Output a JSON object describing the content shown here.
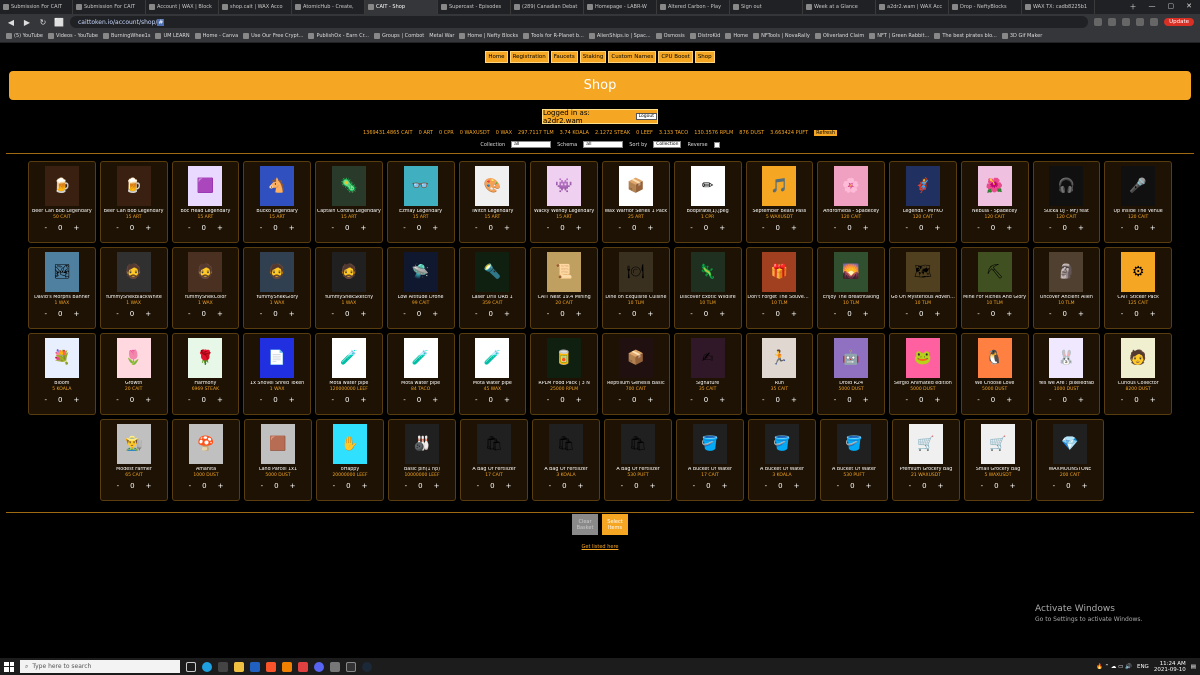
{
  "browser": {
    "tabs": [
      {
        "title": "Submission For CAIT",
        "active": false
      },
      {
        "title": "Submission For CAIT",
        "active": false
      },
      {
        "title": "Account | WAX | Block",
        "active": false
      },
      {
        "title": "shop.cait | WAX Acco",
        "active": false
      },
      {
        "title": "AtomicHub - Create, ",
        "active": false
      },
      {
        "title": "CAIT - Shop",
        "active": true
      },
      {
        "title": "Supercast - Episodes",
        "active": false
      },
      {
        "title": "(289) Canadian Debat",
        "active": false
      },
      {
        "title": "Homepage - LABR-W",
        "active": false
      },
      {
        "title": "Altered Carbon - Play",
        "active": false
      },
      {
        "title": "Sign out",
        "active": false
      },
      {
        "title": "Week at a Glance",
        "active": false
      },
      {
        "title": "a2dr2.wam | WAX Acc",
        "active": false
      },
      {
        "title": "Drop - NeftyBlocks",
        "active": false
      },
      {
        "title": "WAX TX: cadb8225b1",
        "active": false
      }
    ],
    "url_prefix": "caittoken.io/account/shop/",
    "url_selected": "#",
    "update_label": "Update",
    "bookmarks": [
      "(5) YouTube",
      "Videos - YouTube",
      "BurningWhee1s",
      "UM LEARN",
      "Home - Canva",
      "Use Our Free Crypt...",
      "PublishOx - Earn Cr...",
      "Groups | Combot",
      "Home | Nefty Blocks",
      "Tools for R-Planet b...",
      "AlienShips.io | Spac...",
      "Osmosis",
      "DistroKid",
      "Home",
      "NFTools | NovaRally",
      "Oliverland Claim",
      "NFT | Green Rabbit...",
      "The best pirates blo...",
      "3D Gif Maker"
    ],
    "metal_war": "Metal War"
  },
  "nav": [
    "Home",
    "Registration",
    "Faucets",
    "Staking",
    "Custom Names",
    "CPU Boost",
    "Shop"
  ],
  "banner_title": "Shop",
  "login": {
    "text": "Logged in as: a2dr2.wam",
    "logout": "Logout"
  },
  "balances": [
    "1369431.4865 CAIT",
    "0 ART",
    "0 CPR",
    "0 WAXUSDT",
    "0 WAX",
    "297.7117 TLM",
    "3.74 KOALA",
    "2.1272 STEAK",
    "0 LEEF",
    "3.133 TACO",
    "130.3576 RPLM",
    "876 DUST",
    "3.663424 PUFT"
  ],
  "refresh_label": "Refresh",
  "filters": {
    "collection_label": "Collection",
    "collection_value": "all",
    "schema_label": "Schema",
    "schema_value": "all",
    "sort_label": "Sort by",
    "sort_value": "Collection",
    "reverse_label": "Reverse"
  },
  "qty_minus": "-",
  "qty_value": "0",
  "qty_plus": "+",
  "rows": [
    [
      {
        "name": "Beer Can Bob Legendary",
        "price": "50 CAIT",
        "icon": "🍺",
        "bg": "#3a2010"
      },
      {
        "name": "Beer Can Bob Legendary",
        "price": "15 ART",
        "icon": "🍺",
        "bg": "#3a2010"
      },
      {
        "name": "Boc Head Legendary",
        "price": "15 ART",
        "icon": "🟪",
        "bg": "#e9d8ff"
      },
      {
        "name": "Bucko Legendary",
        "price": "15 ART",
        "icon": "🐴",
        "bg": "#3050c0"
      },
      {
        "name": "Captain Corona Legendary",
        "price": "15 ART",
        "icon": "🦠",
        "bg": "#2a3a2a"
      },
      {
        "name": "Ezmay Legendary",
        "price": "15 ART",
        "icon": "👓",
        "bg": "#40b0c0"
      },
      {
        "name": "Twitch Legendary",
        "price": "15 ART",
        "icon": "🎨",
        "bg": "#f0f0f0"
      },
      {
        "name": "Wacky Wendy Legendary",
        "price": "15 ART",
        "icon": "👾",
        "bg": "#f0d0f0"
      },
      {
        "name": "Wax Warrior Series 1 Pack",
        "price": "25 ART",
        "icon": "📦",
        "bg": "#ffffff"
      },
      {
        "name": "Bodpirate(1).jpeg",
        "price": "1 CPR",
        "icon": "✏",
        "bg": "#ffffff"
      },
      {
        "name": "September Beats Pass",
        "price": "5 WAXUSDT",
        "icon": "🎵",
        "bg": "#f5a623"
      },
      {
        "name": "Andromeda - Spadecey",
        "price": "120 CAIT",
        "icon": "🌸",
        "bg": "#f0a0c0"
      },
      {
        "name": "Legends - MIYKO",
        "price": "120 CAIT",
        "icon": "🦸",
        "bg": "#203060"
      },
      {
        "name": "Nebula - Spadecey",
        "price": "120 CAIT",
        "icon": "🌺",
        "bg": "#f0c0e0"
      },
      {
        "name": "Sucka DJ - MFJ feat",
        "price": "120 CAIT",
        "icon": "🎧",
        "bg": "#101010"
      },
      {
        "name": "Up Inside The Venue",
        "price": "120 CAIT",
        "icon": "🎤",
        "bg": "#101010"
      }
    ],
    [
      {
        "name": "David's Morphs Banner",
        "price": "1 WAX",
        "icon": "🏞",
        "bg": "#5080a0"
      },
      {
        "name": "YummySnekBlackWhite",
        "price": "1 WAX",
        "icon": "🧔",
        "bg": "#303030"
      },
      {
        "name": "YummySnekColor",
        "price": "1 WAX",
        "icon": "🧔",
        "bg": "#4a3020"
      },
      {
        "name": "YummySnekGlory",
        "price": "1 WAX",
        "icon": "🧔",
        "bg": "#304050"
      },
      {
        "name": "YummySnekSketchy",
        "price": "1 WAX",
        "icon": "🧔",
        "bg": "#202020"
      },
      {
        "name": "Low Altitude Drone",
        "price": "99 CAIT",
        "icon": "🛸",
        "bg": "#101830"
      },
      {
        "name": "Laser Drill ORB 1",
        "price": "359 CAIT",
        "icon": "🔦",
        "bg": "#102010"
      },
      {
        "name": "CAIT Nest 19.4 Mining",
        "price": "20 CAIT",
        "icon": "📜",
        "bg": "#c0a060"
      },
      {
        "name": "Dine on Exquisite Cuisine",
        "price": "10 TLM",
        "icon": "🍽",
        "bg": "#3a3020"
      },
      {
        "name": "Discover Exotic Wildlife",
        "price": "10 TLM",
        "icon": "🦎",
        "bg": "#203020"
      },
      {
        "name": "Don't Forget The Souvenirs",
        "price": "10 TLM",
        "icon": "🎁",
        "bg": "#a04020"
      },
      {
        "name": "Enjoy The Breathtaking",
        "price": "10 TLM",
        "icon": "🌄",
        "bg": "#305030"
      },
      {
        "name": "Go On Mysterious Adventure",
        "price": "10 TLM",
        "icon": "🗺",
        "bg": "#504020"
      },
      {
        "name": "Mine For Riches And Glory",
        "price": "10 TLM",
        "icon": "⛏",
        "bg": "#405020"
      },
      {
        "name": "Uncover Ancient Alien",
        "price": "10 TLM",
        "icon": "🗿",
        "bg": "#504030"
      },
      {
        "name": "CAIT Sticker Pack",
        "price": "125 CAIT",
        "icon": "⚙",
        "bg": "#f5a623"
      }
    ],
    [
      {
        "name": "Bloom",
        "price": "5 KOALA",
        "icon": "💐",
        "bg": "#e8f0ff"
      },
      {
        "name": "Growth",
        "price": "20 CAIT",
        "icon": "🌷",
        "bg": "#ffd8e0"
      },
      {
        "name": "Harmony",
        "price": "6969 STEAK",
        "icon": "🌹",
        "bg": "#e8f8e8"
      },
      {
        "name": "1x Shovel Shred Token",
        "price": "1 WAX",
        "icon": "📄",
        "bg": "#2030e0"
      },
      {
        "name": "Mota water pipe",
        "price": "120000000 LEEF",
        "icon": "🧪",
        "bg": "#ffffff"
      },
      {
        "name": "Mota water pipe",
        "price": "84 TACO",
        "icon": "🧪",
        "bg": "#ffffff"
      },
      {
        "name": "Mota water pipe",
        "price": "45 WAX",
        "icon": "🧪",
        "bg": "#ffffff"
      },
      {
        "name": "RPLM Food Pack | 3 N",
        "price": "25000 RPLM",
        "icon": "🥫",
        "bg": "#102010"
      },
      {
        "name": "Reptilium Genesis Basic",
        "price": "700 CAIT",
        "icon": "📦",
        "bg": "#201010"
      },
      {
        "name": "Signature",
        "price": "35 CAIT",
        "icon": "✍",
        "bg": "#301828"
      },
      {
        "name": "Run",
        "price": "35 CAIT",
        "icon": "🏃",
        "bg": "#e0d8d0"
      },
      {
        "name": "Droid R24",
        "price": "5000 DUST",
        "icon": "🤖",
        "bg": "#9070c0"
      },
      {
        "name": "Sergio Animated edition",
        "price": "5000 DUST",
        "icon": "🐸",
        "bg": "#ff60a0"
      },
      {
        "name": "We Choose Love",
        "price": "5000 DUST",
        "icon": "🐧",
        "bg": "#ff8040"
      },
      {
        "name": "Yes we Are : pixeledfab",
        "price": "1000 DUST",
        "icon": "🐰",
        "bg": "#f0e8ff"
      },
      {
        "name": "Curious Collector",
        "price": "8200 DUST",
        "icon": "🧑",
        "bg": "#f0f0d0"
      }
    ],
    [
      {
        "name": "Modest Farmer",
        "price": "65 CAIT",
        "icon": "👨‍🌾",
        "bg": "#c0c0c0"
      },
      {
        "name": "Amanita",
        "price": "1000 DUST",
        "icon": "🍄",
        "bg": "#c0c0c0"
      },
      {
        "name": "Land Parcel 1x1",
        "price": "5000 DUST",
        "icon": "🟫",
        "bg": "#c0c0c0"
      },
      {
        "name": "oHappy",
        "price": "20000000 LEEF",
        "icon": "✋",
        "bg": "#30e0ff"
      },
      {
        "name": "Basic pin(1 hp)",
        "price": "10000000 LEEF",
        "icon": "🎳",
        "bg": "#202020"
      },
      {
        "name": "A Bag Of Fertilizer",
        "price": "17 CAIT",
        "icon": "🛍",
        "bg": "#202020"
      },
      {
        "name": "A Bag Of Fertilizer",
        "price": "3 KOALA",
        "icon": "🛍",
        "bg": "#202020"
      },
      {
        "name": "A Bag Of Fertilizer",
        "price": "530 PUFT",
        "icon": "🛍",
        "bg": "#202020"
      },
      {
        "name": "A Bucket Of Water",
        "price": "17 CAIT",
        "icon": "🪣",
        "bg": "#202020"
      },
      {
        "name": "A Bucket Of Water",
        "price": "3 KOALA",
        "icon": "🪣",
        "bg": "#202020"
      },
      {
        "name": "A Bucket Of Water",
        "price": "530 PUFT",
        "icon": "🪣",
        "bg": "#202020"
      },
      {
        "name": "Premium Grocery Bag",
        "price": "21 WAXUSDT",
        "icon": "🛒",
        "bg": "#f0f0f0"
      },
      {
        "name": "Small Grocery Bag",
        "price": "5 WAXUSDT",
        "icon": "🛒",
        "bg": "#f0f0f0"
      },
      {
        "name": "WAXMOONSTONE",
        "price": "200 CAIT",
        "icon": "💎",
        "bg": "#202020"
      }
    ]
  ],
  "clear_label": "Clear Basket",
  "select_label": "Select Items",
  "get_listed": "Get listed here",
  "activate": {
    "title": "Activate Windows",
    "subtitle": "Go to Settings to activate Windows."
  },
  "taskbar": {
    "search_placeholder": "Type here to search",
    "lang": "ENG",
    "time": "11:24 AM",
    "date": "2021-09-10"
  }
}
